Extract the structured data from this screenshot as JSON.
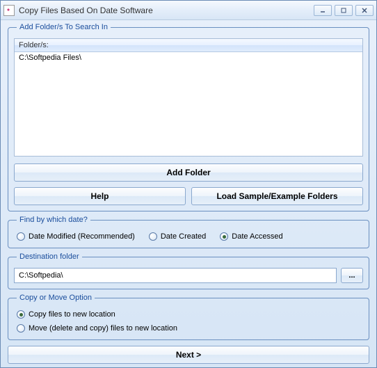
{
  "window": {
    "title": "Copy Files Based On Date Software"
  },
  "group_folders": {
    "legend": "Add Folder/s To Search In",
    "header": "Folder/s:",
    "items": [
      "C:\\Softpedia Files\\"
    ],
    "add_button": "Add Folder",
    "help_button": "Help",
    "load_sample_button": "Load Sample/Example Folders"
  },
  "group_date": {
    "legend": "Find by which date?",
    "options": {
      "modified": {
        "label": "Date Modified (Recommended)",
        "checked": false
      },
      "created": {
        "label": "Date Created",
        "checked": false
      },
      "accessed": {
        "label": "Date Accessed",
        "checked": true
      }
    }
  },
  "group_dest": {
    "legend": "Destination folder",
    "value": "C:\\Softpedia\\",
    "browse": "..."
  },
  "group_copymove": {
    "legend": "Copy or Move Option",
    "options": {
      "copy": {
        "label": "Copy files to new location",
        "checked": true
      },
      "move": {
        "label": "Move (delete and copy) files to new location",
        "checked": false
      }
    }
  },
  "next_button": "Next >"
}
